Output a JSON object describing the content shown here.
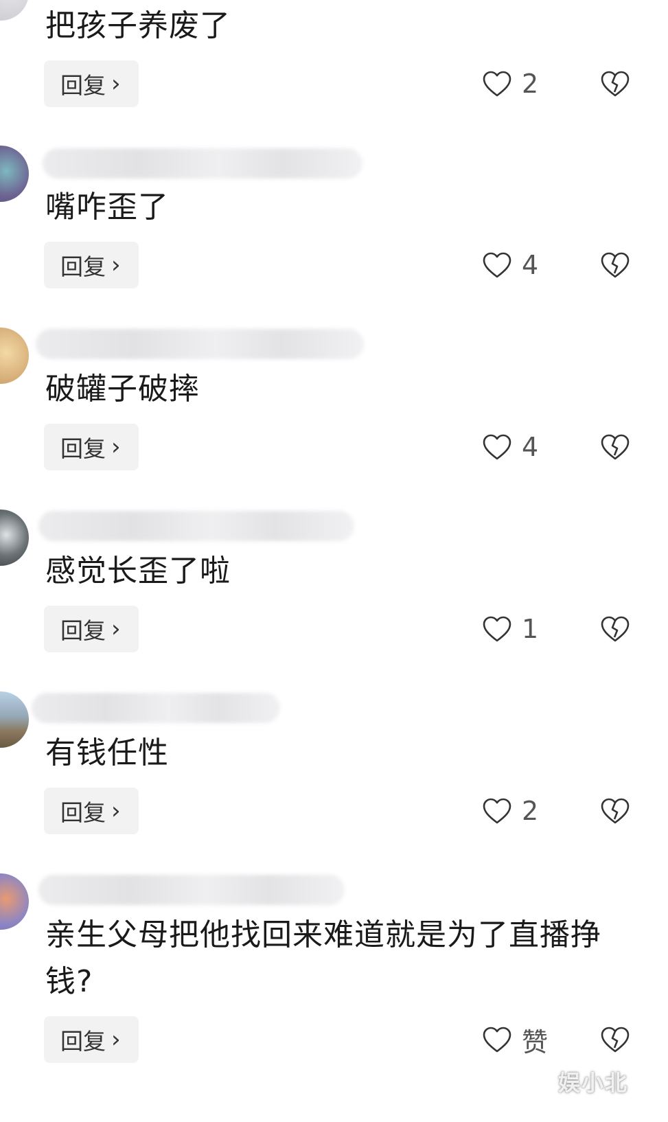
{
  "comments": [
    {
      "text": "把孩子养废了",
      "reply_label": "回复",
      "likes": "2"
    },
    {
      "text": "嘴咋歪了",
      "reply_label": "回复",
      "likes": "4"
    },
    {
      "text": "破罐子破摔",
      "reply_label": "回复",
      "likes": "4"
    },
    {
      "text": "感觉长歪了啦",
      "reply_label": "回复",
      "likes": "1"
    },
    {
      "text": "有钱任性",
      "reply_label": "回复",
      "likes": "2"
    },
    {
      "text": "亲生父母把他找回来难道就是为了直播挣钱?",
      "reply_label": "回复",
      "likes": "赞"
    }
  ],
  "icons": {
    "chevron": "chevron-right-icon",
    "like": "heart-outline-icon",
    "dislike": "broken-heart-icon"
  },
  "watermark": "娱小北"
}
